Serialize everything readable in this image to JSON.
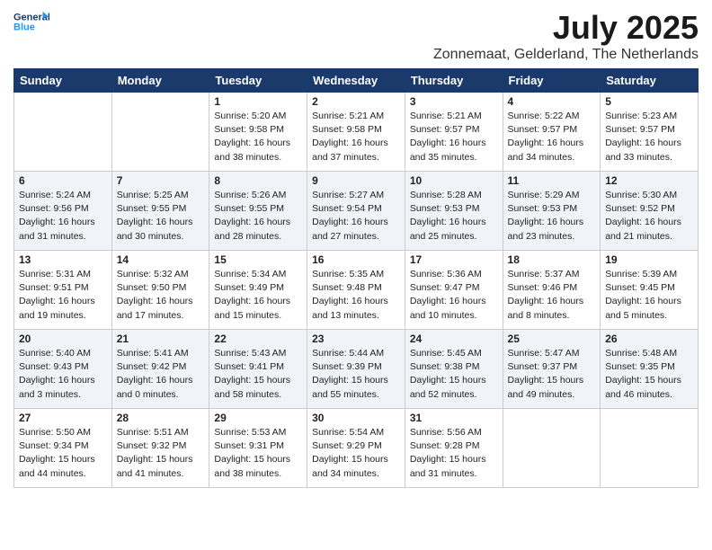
{
  "header": {
    "logo_line1": "General",
    "logo_line2": "Blue",
    "month": "July 2025",
    "location": "Zonnemaat, Gelderland, The Netherlands"
  },
  "weekdays": [
    "Sunday",
    "Monday",
    "Tuesday",
    "Wednesday",
    "Thursday",
    "Friday",
    "Saturday"
  ],
  "weeks": [
    [
      {
        "day": "",
        "info": ""
      },
      {
        "day": "",
        "info": ""
      },
      {
        "day": "1",
        "info": "Sunrise: 5:20 AM\nSunset: 9:58 PM\nDaylight: 16 hours\nand 38 minutes."
      },
      {
        "day": "2",
        "info": "Sunrise: 5:21 AM\nSunset: 9:58 PM\nDaylight: 16 hours\nand 37 minutes."
      },
      {
        "day": "3",
        "info": "Sunrise: 5:21 AM\nSunset: 9:57 PM\nDaylight: 16 hours\nand 35 minutes."
      },
      {
        "day": "4",
        "info": "Sunrise: 5:22 AM\nSunset: 9:57 PM\nDaylight: 16 hours\nand 34 minutes."
      },
      {
        "day": "5",
        "info": "Sunrise: 5:23 AM\nSunset: 9:57 PM\nDaylight: 16 hours\nand 33 minutes."
      }
    ],
    [
      {
        "day": "6",
        "info": "Sunrise: 5:24 AM\nSunset: 9:56 PM\nDaylight: 16 hours\nand 31 minutes."
      },
      {
        "day": "7",
        "info": "Sunrise: 5:25 AM\nSunset: 9:55 PM\nDaylight: 16 hours\nand 30 minutes."
      },
      {
        "day": "8",
        "info": "Sunrise: 5:26 AM\nSunset: 9:55 PM\nDaylight: 16 hours\nand 28 minutes."
      },
      {
        "day": "9",
        "info": "Sunrise: 5:27 AM\nSunset: 9:54 PM\nDaylight: 16 hours\nand 27 minutes."
      },
      {
        "day": "10",
        "info": "Sunrise: 5:28 AM\nSunset: 9:53 PM\nDaylight: 16 hours\nand 25 minutes."
      },
      {
        "day": "11",
        "info": "Sunrise: 5:29 AM\nSunset: 9:53 PM\nDaylight: 16 hours\nand 23 minutes."
      },
      {
        "day": "12",
        "info": "Sunrise: 5:30 AM\nSunset: 9:52 PM\nDaylight: 16 hours\nand 21 minutes."
      }
    ],
    [
      {
        "day": "13",
        "info": "Sunrise: 5:31 AM\nSunset: 9:51 PM\nDaylight: 16 hours\nand 19 minutes."
      },
      {
        "day": "14",
        "info": "Sunrise: 5:32 AM\nSunset: 9:50 PM\nDaylight: 16 hours\nand 17 minutes."
      },
      {
        "day": "15",
        "info": "Sunrise: 5:34 AM\nSunset: 9:49 PM\nDaylight: 16 hours\nand 15 minutes."
      },
      {
        "day": "16",
        "info": "Sunrise: 5:35 AM\nSunset: 9:48 PM\nDaylight: 16 hours\nand 13 minutes."
      },
      {
        "day": "17",
        "info": "Sunrise: 5:36 AM\nSunset: 9:47 PM\nDaylight: 16 hours\nand 10 minutes."
      },
      {
        "day": "18",
        "info": "Sunrise: 5:37 AM\nSunset: 9:46 PM\nDaylight: 16 hours\nand 8 minutes."
      },
      {
        "day": "19",
        "info": "Sunrise: 5:39 AM\nSunset: 9:45 PM\nDaylight: 16 hours\nand 5 minutes."
      }
    ],
    [
      {
        "day": "20",
        "info": "Sunrise: 5:40 AM\nSunset: 9:43 PM\nDaylight: 16 hours\nand 3 minutes."
      },
      {
        "day": "21",
        "info": "Sunrise: 5:41 AM\nSunset: 9:42 PM\nDaylight: 16 hours\nand 0 minutes."
      },
      {
        "day": "22",
        "info": "Sunrise: 5:43 AM\nSunset: 9:41 PM\nDaylight: 15 hours\nand 58 minutes."
      },
      {
        "day": "23",
        "info": "Sunrise: 5:44 AM\nSunset: 9:39 PM\nDaylight: 15 hours\nand 55 minutes."
      },
      {
        "day": "24",
        "info": "Sunrise: 5:45 AM\nSunset: 9:38 PM\nDaylight: 15 hours\nand 52 minutes."
      },
      {
        "day": "25",
        "info": "Sunrise: 5:47 AM\nSunset: 9:37 PM\nDaylight: 15 hours\nand 49 minutes."
      },
      {
        "day": "26",
        "info": "Sunrise: 5:48 AM\nSunset: 9:35 PM\nDaylight: 15 hours\nand 46 minutes."
      }
    ],
    [
      {
        "day": "27",
        "info": "Sunrise: 5:50 AM\nSunset: 9:34 PM\nDaylight: 15 hours\nand 44 minutes."
      },
      {
        "day": "28",
        "info": "Sunrise: 5:51 AM\nSunset: 9:32 PM\nDaylight: 15 hours\nand 41 minutes."
      },
      {
        "day": "29",
        "info": "Sunrise: 5:53 AM\nSunset: 9:31 PM\nDaylight: 15 hours\nand 38 minutes."
      },
      {
        "day": "30",
        "info": "Sunrise: 5:54 AM\nSunset: 9:29 PM\nDaylight: 15 hours\nand 34 minutes."
      },
      {
        "day": "31",
        "info": "Sunrise: 5:56 AM\nSunset: 9:28 PM\nDaylight: 15 hours\nand 31 minutes."
      },
      {
        "day": "",
        "info": ""
      },
      {
        "day": "",
        "info": ""
      }
    ]
  ]
}
